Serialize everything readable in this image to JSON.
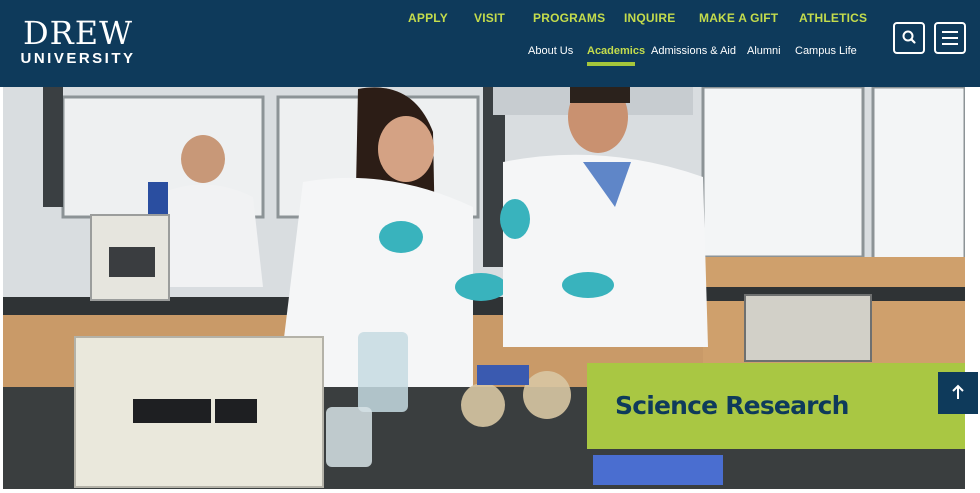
{
  "logo": {
    "line1": "DREW",
    "line2": "UNIVERSITY"
  },
  "utility_nav": [
    "APPLY",
    "VISIT",
    "PROGRAMS",
    "INQUIRE",
    "MAKE A GIFT",
    "ATHLETICS"
  ],
  "main_nav": [
    {
      "label": "About Us",
      "active": false
    },
    {
      "label": "Academics",
      "active": true
    },
    {
      "label": "Admissions & Aid",
      "active": false
    },
    {
      "label": "Alumni",
      "active": false
    },
    {
      "label": "Campus Life",
      "active": false
    }
  ],
  "hero": {
    "caption": "Science Research"
  },
  "colors": {
    "navy": "#0e3a5b",
    "lime": "#a9c743",
    "nav_accent": "#c4dc4c"
  },
  "icons": {
    "search": "search-icon",
    "menu": "hamburger-menu-icon",
    "back_to_top": "arrow-up-icon"
  }
}
